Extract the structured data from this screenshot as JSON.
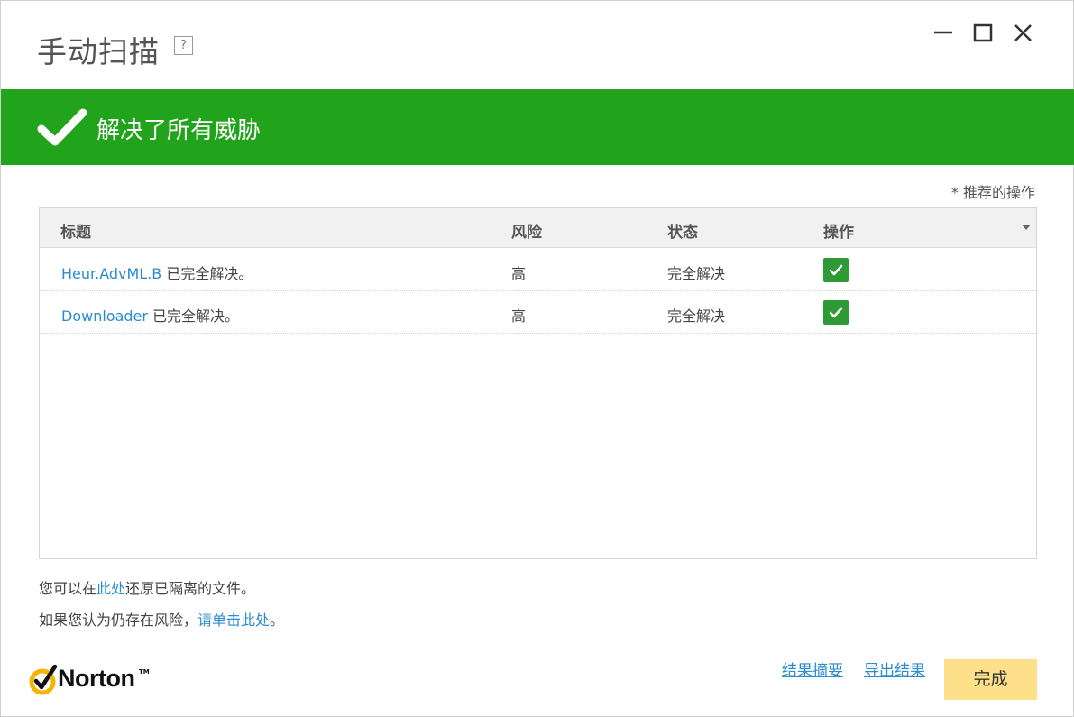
{
  "window": {
    "title": "手动扫描",
    "help_label": "?",
    "controls": {
      "minimize": "minimize-icon",
      "maximize": "maximize-icon",
      "close": "close-icon"
    }
  },
  "banner": {
    "text": "解决了所有威胁",
    "icon": "checkmark-icon",
    "color": "#22a31c"
  },
  "recommend_label": "* 推荐的操作",
  "table": {
    "headers": {
      "title": "标题",
      "risk": "风险",
      "status": "状态",
      "action": "操作"
    },
    "rows": [
      {
        "name": "Heur.AdvML.B",
        "suffix": " 已完全解决。",
        "risk": "高",
        "status": "完全解决",
        "action_checked": true
      },
      {
        "name": "Downloader",
        "suffix": " 已完全解决。",
        "risk": "高",
        "status": "完全解决",
        "action_checked": true
      }
    ]
  },
  "info": {
    "line1_prefix": "您可以在",
    "line1_link": "此处",
    "line1_suffix": "还原已隔离的文件。",
    "line2_prefix": "如果您认为仍存在风险，",
    "line2_link": "请单击此处",
    "line2_suffix": "。"
  },
  "footer": {
    "brand": "Norton",
    "brand_tm": "TM",
    "summary_link": "结果摘要",
    "export_link": "导出结果",
    "done_button": "完成"
  },
  "colors": {
    "accent_green": "#22a31c",
    "link_blue": "#2b8ccf",
    "button_yellow": "#ffe08a",
    "logo_gold": "#f4b400"
  }
}
